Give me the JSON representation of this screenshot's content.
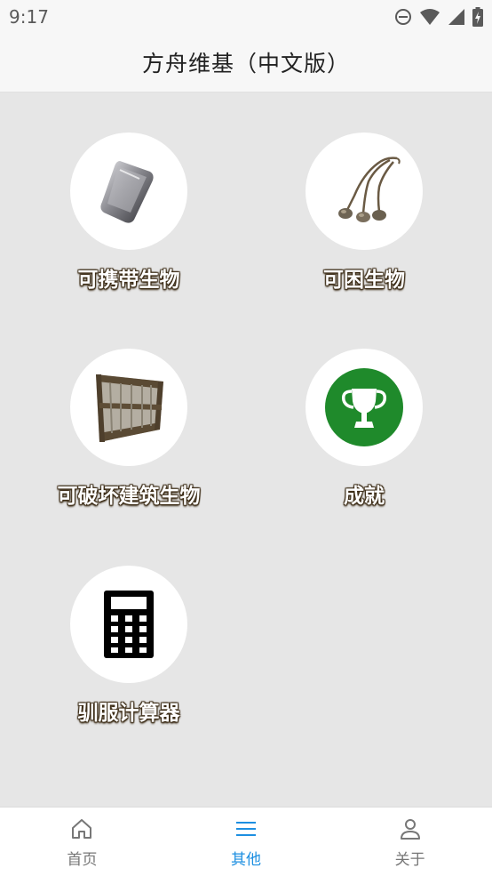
{
  "status_bar": {
    "time": "9:17",
    "icons": [
      "do-not-disturb-icon",
      "wifi-icon",
      "signal-icon",
      "battery-charging-icon"
    ]
  },
  "header": {
    "title": "方舟维基（中文版）"
  },
  "menu": {
    "items": [
      {
        "label": "可携带生物",
        "icon": "metal-ingot-icon"
      },
      {
        "label": "可困生物",
        "icon": "bola-icon"
      },
      {
        "label": "可破坏建筑生物",
        "icon": "wooden-wall-icon"
      },
      {
        "label": "成就",
        "icon": "trophy-icon"
      },
      {
        "label": "驯服计算器",
        "icon": "calculator-icon"
      }
    ]
  },
  "tab_bar": {
    "tabs": [
      {
        "label": "首页",
        "icon": "home-icon",
        "active": false
      },
      {
        "label": "其他",
        "icon": "menu-icon",
        "active": true
      },
      {
        "label": "关于",
        "icon": "user-icon",
        "active": false
      }
    ],
    "active_color": "#1d8fe1",
    "inactive_color": "#777777"
  },
  "colors": {
    "trophy_green": "#1f8a2b",
    "background": "#e6e6e6"
  }
}
